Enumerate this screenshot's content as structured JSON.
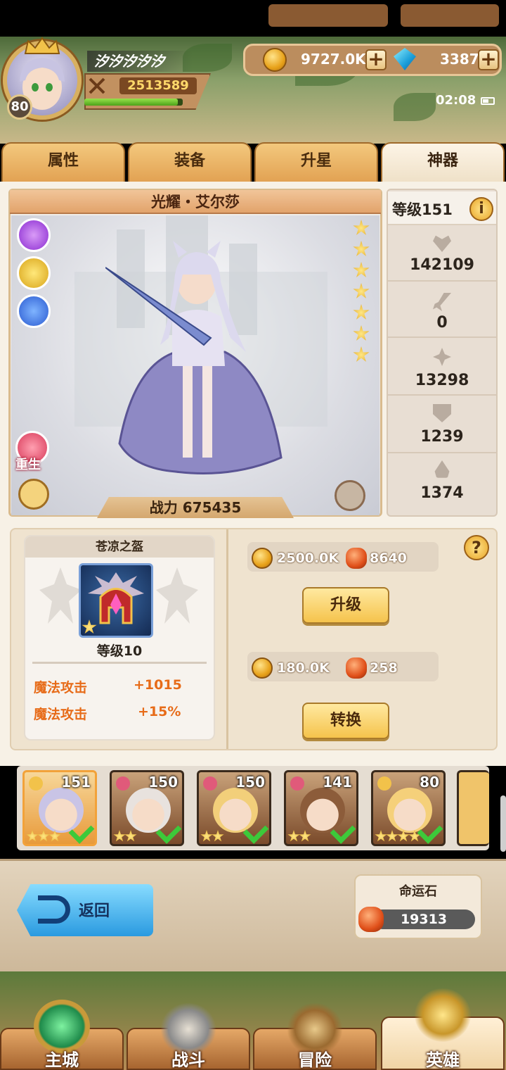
{
  "player": {
    "name": "汐汐汐汐汐",
    "level": "80",
    "power": "2513589",
    "xp_fraction": 0.95
  },
  "resources": {
    "gold": "9727.0K",
    "gems": "3387"
  },
  "status": {
    "time": "02:08"
  },
  "tabs": [
    "属性",
    "装备",
    "升星",
    "神器"
  ],
  "active_tab": "神器",
  "hero": {
    "name": "光耀・艾尔莎",
    "combat_label": "战力",
    "combat_value": "675435",
    "stars": 7,
    "rebirth_label": "重生"
  },
  "stats": {
    "level_label": "等级151",
    "hp": "142109",
    "attack": "0",
    "magic": "13298",
    "defense": "1239",
    "resist": "1374"
  },
  "artifact": {
    "name": "苍凉之盔",
    "level": "等级10",
    "bonuses": [
      {
        "label": "魔法攻击",
        "value": "+1015"
      },
      {
        "label": "魔法攻击",
        "value": "+15%"
      }
    ],
    "upgrade_cost": {
      "gold": "2500.0K",
      "stone": "8640"
    },
    "upgrade_label": "升级",
    "convert_cost": {
      "gold": "180.0K",
      "stone": "258"
    },
    "convert_label": "转换"
  },
  "roster": [
    {
      "level": "151",
      "stars": 3,
      "selected": true,
      "face": "#c9c4e6"
    },
    {
      "level": "150",
      "stars": 2,
      "selected": false,
      "face": "#e8e2de"
    },
    {
      "level": "150",
      "stars": 2,
      "selected": false,
      "face": "#f2cf7a"
    },
    {
      "level": "141",
      "stars": 2,
      "selected": false,
      "face": "#8c5c3a"
    },
    {
      "level": "80",
      "stars": 4,
      "selected": false,
      "face": "#f5d07a"
    }
  ],
  "footer": {
    "back_label": "返回",
    "fate_label": "命运石",
    "fate_value": "19313"
  },
  "nav": [
    "主城",
    "战斗",
    "冒险",
    "英雄"
  ],
  "colors": {
    "accent": "#e76b18",
    "tab_active": "#f4ead9",
    "tab": "#e9b56a"
  }
}
